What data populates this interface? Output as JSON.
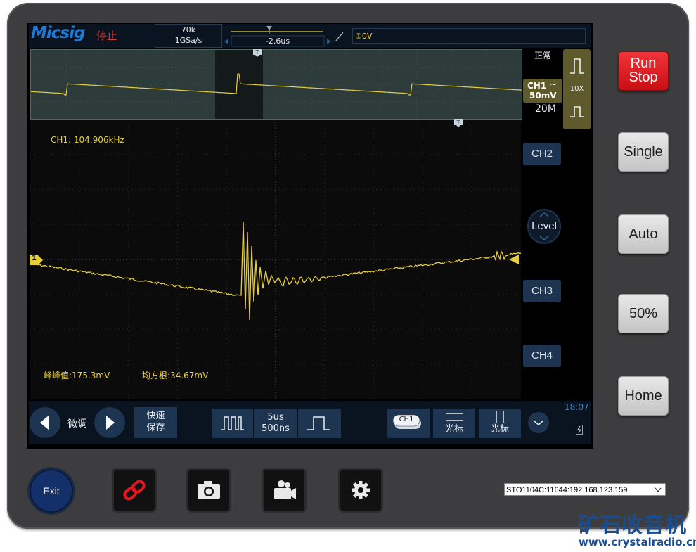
{
  "brand": "Micsig",
  "status": "停止",
  "acquisition": {
    "memory": "70k",
    "sample_rate": "1GSa/s"
  },
  "timebase_offset": "-2.6us",
  "trigger": {
    "slope_icon": "rising-edge-icon",
    "level": "①0V",
    "mode": "正常"
  },
  "channel1": {
    "label": "CH1",
    "coupling_icon": "ac-coupling-icon",
    "scale": "50mV",
    "probe": "10X",
    "bandwidth": "20M"
  },
  "right_buttons": {
    "ch2": "CH2",
    "level": "Level",
    "ch3": "CH3",
    "ch4": "CH4"
  },
  "measurements": {
    "frequency": "CH1: 104.906kHz",
    "peak_to_peak": "峰峰值:175.3mV",
    "rms": "均方根:34.67mV"
  },
  "ch1_marker": "1",
  "toolbar": {
    "fine_label": "微调",
    "quick_save_line1": "快速",
    "quick_save_line2": "保存",
    "timebase_primary": "5us",
    "timebase_secondary": "500ns",
    "ch1_chip": "CH1",
    "cursor_h_label": "光标",
    "cursor_v_label": "光标",
    "time": "18:07"
  },
  "hardware": {
    "run_stop_line1": "Run",
    "run_stop_line2": "Stop",
    "single": "Single",
    "auto": "Auto",
    "fifty": "50%",
    "home": "Home",
    "exit": "Exit"
  },
  "device_select": "STO1104C:11644:192.168.123.159",
  "watermark": {
    "title": "矿石收音机",
    "url": "www.crystalradio.cn"
  },
  "colors": {
    "trace": "#e8cf3a",
    "run_stop": "#e0161c",
    "panel": "#1d3550",
    "brand": "#1d7ad6"
  }
}
